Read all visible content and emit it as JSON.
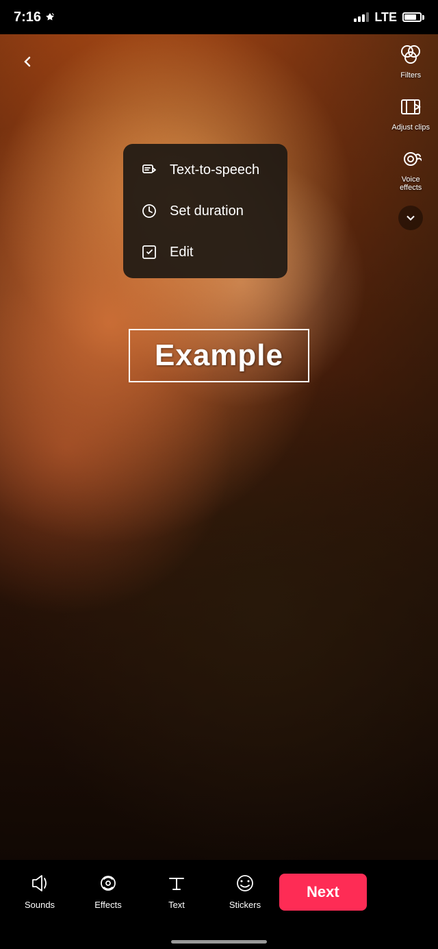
{
  "statusBar": {
    "time": "7:16",
    "lte": "LTE",
    "hasLocation": true
  },
  "toolbar": {
    "filters_label": "Filters",
    "adjust_clips_label": "Adjust clips",
    "voice_effects_label": "Voice\neffects"
  },
  "contextMenu": {
    "items": [
      {
        "id": "text-to-speech",
        "label": "Text-to-speech",
        "icon": "text-to-speech"
      },
      {
        "id": "set-duration",
        "label": "Set duration",
        "icon": "clock"
      },
      {
        "id": "edit",
        "label": "Edit",
        "icon": "edit"
      }
    ]
  },
  "overlay": {
    "text": "Example"
  },
  "bottomBar": {
    "sounds_label": "Sounds",
    "effects_label": "Effects",
    "text_label": "Text",
    "stickers_label": "Stickers",
    "next_label": "Next"
  }
}
